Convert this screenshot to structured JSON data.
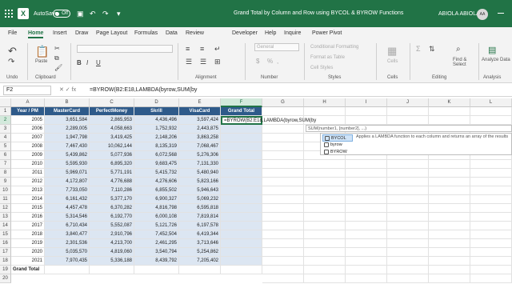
{
  "titlebar": {
    "autosave_label": "AutoSave",
    "autosave_state": "Off",
    "doc_title": "Grand Total by Column and Row using BYCOL & BYROW Functions",
    "user_name": "ABIOLA ABIOLA",
    "user_initials": "AA",
    "brand_color": "#217346"
  },
  "tabs": [
    "File",
    "Home",
    "Insert",
    "Draw",
    "Page Layout",
    "Formulas",
    "Data",
    "Review",
    "Developer",
    "Help",
    "Inquire",
    "Power Pivot"
  ],
  "active_tab": "Home",
  "ribbon": {
    "undo_label": "Undo",
    "paste_label": "Paste",
    "clipboard_label": "Clipboard",
    "alignment_label": "Alignment",
    "number_format": "General",
    "number_label": "Number",
    "conditional_formatting": "Conditional Formatting",
    "format_as_table": "Format as Table",
    "cell_styles": "Cell Styles",
    "styles_label": "Styles",
    "cells_label": "Cells",
    "cells_button": "Cells",
    "find_select": "Find & Select",
    "editing_label": "Editing",
    "analyze_data": "Analyze Data",
    "analysis_label": "Analysis"
  },
  "formula_bar": {
    "name_box": "F2",
    "formula": "=BYROW(B2:E18,LAMBDA(byrow,SUM(by"
  },
  "columns": [
    "A",
    "B",
    "C",
    "D",
    "E",
    "F",
    "G",
    "H",
    "I",
    "J",
    "K",
    "L"
  ],
  "headers": [
    "Year / PM",
    "MasterCard",
    "PerfectMoney",
    "Skrill",
    "VisaCard",
    "Grand Total"
  ],
  "rows": [
    [
      "2005",
      "3,651,584",
      "2,865,953",
      "4,436,496",
      "3,597,424"
    ],
    [
      "2006",
      "2,289,005",
      "4,058,663",
      "1,752,932",
      "2,443,875"
    ],
    [
      "2007",
      "1,947,798",
      "3,419,425",
      "2,148,206",
      "3,863,258"
    ],
    [
      "2008",
      "7,467,430",
      "10,062,144",
      "8,135,319",
      "7,068,467"
    ],
    [
      "2009",
      "5,439,862",
      "5,077,936",
      "6,072,568",
      "5,276,306"
    ],
    [
      "2010",
      "5,595,930",
      "6,895,320",
      "9,683,475",
      "7,131,330"
    ],
    [
      "2011",
      "5,969,071",
      "5,771,191",
      "5,415,732",
      "5,480,940"
    ],
    [
      "2012",
      "4,172,807",
      "4,776,688",
      "4,276,606",
      "5,823,166"
    ],
    [
      "2013",
      "7,733,050",
      "7,110,286",
      "6,855,502",
      "5,946,643"
    ],
    [
      "2014",
      "6,161,432",
      "5,377,170",
      "6,900,327",
      "5,069,232"
    ],
    [
      "2015",
      "4,457,478",
      "6,370,282",
      "4,816,798",
      "6,595,818"
    ],
    [
      "2016",
      "5,314,546",
      "6,192,770",
      "6,000,108",
      "7,819,814"
    ],
    [
      "2017",
      "6,710,434",
      "5,552,087",
      "5,121,726",
      "6,197,578"
    ],
    [
      "2018",
      "3,840,477",
      "2,910,796",
      "7,452,504",
      "6,419,344"
    ],
    [
      "2019",
      "2,301,536",
      "4,213,700",
      "2,461,295",
      "3,713,646"
    ],
    [
      "2020",
      "5,035,570",
      "4,819,060",
      "3,540,794",
      "5,254,862"
    ],
    [
      "2021",
      "7,970,435",
      "5,336,188",
      "8,439,792",
      "7,205,402"
    ]
  ],
  "grand_total_label": "Grand Total",
  "editing_cell_text": "=BYROW(B2:E18,LAMBDA(byrow,SUM(by",
  "tooltip_text": "SUM(number1, [number2], ...)",
  "autocomplete": {
    "items": [
      "BYCOL",
      "byrow",
      "BYROW"
    ],
    "selected": "BYCOL",
    "description": "Applies a LAMBDA function to each column and returns an array of the results"
  }
}
